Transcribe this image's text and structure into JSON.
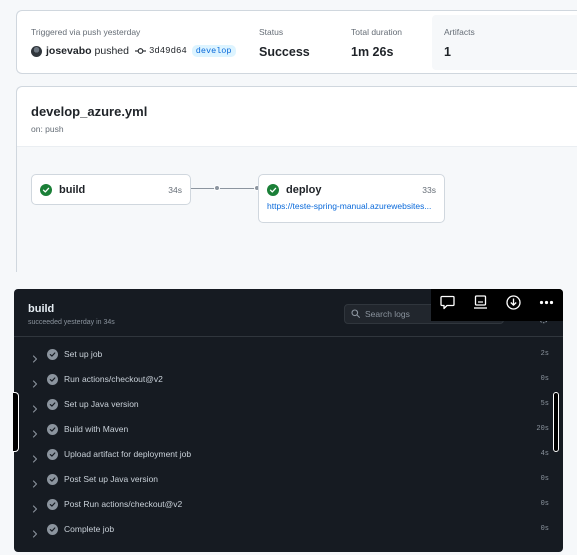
{
  "summary": {
    "trigger_label": "Triggered via push yesterday",
    "actor": "josevabo",
    "action": "pushed",
    "sha": "3d49d64",
    "branch": "develop",
    "status_label": "Status",
    "status_value": "Success",
    "duration_label": "Total duration",
    "duration_value": "1m 26s",
    "artifacts_label": "Artifacts",
    "artifacts_value": "1"
  },
  "workflow": {
    "name": "develop_azure.yml",
    "on": "on: push",
    "jobs": [
      {
        "name": "build",
        "time": "34s"
      },
      {
        "name": "deploy",
        "time": "33s",
        "link": "https://teste-spring-manual.azurewebsites..."
      }
    ]
  },
  "log": {
    "job_name": "build",
    "subtitle": "succeeded yesterday in 34s",
    "search_placeholder": "Search logs",
    "steps": [
      {
        "name": "Set up job",
        "time": "2s"
      },
      {
        "name": "Run actions/checkout@v2",
        "time": "0s"
      },
      {
        "name": "Set up Java version",
        "time": "5s"
      },
      {
        "name": "Build with Maven",
        "time": "20s"
      },
      {
        "name": "Upload artifact for deployment job",
        "time": "4s"
      },
      {
        "name": "Post Set up Java version",
        "time": "0s"
      },
      {
        "name": "Post Run actions/checkout@v2",
        "time": "0s"
      },
      {
        "name": "Complete job",
        "time": "0s"
      }
    ]
  },
  "colors": {
    "success": "#1a7f37",
    "link": "#0969da",
    "dark_panel": "#161b22"
  },
  "icons": {
    "toolbar": [
      "comment-icon",
      "screen-icon",
      "download-icon",
      "more-icon"
    ],
    "step": [
      "chevron-right-icon",
      "check-circle-icon"
    ]
  }
}
